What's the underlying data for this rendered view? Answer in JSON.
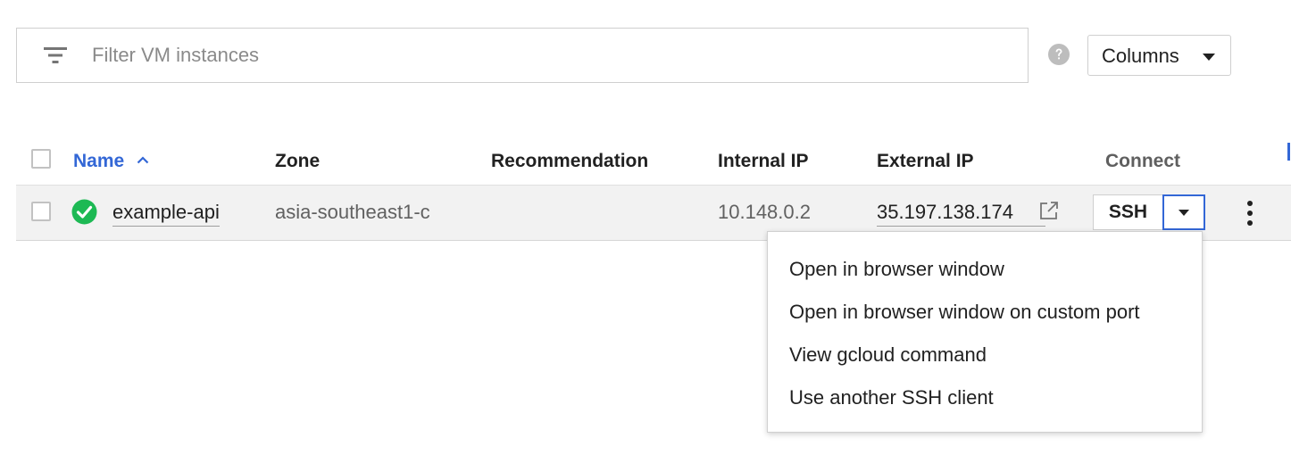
{
  "filter": {
    "placeholder": "Filter VM instances",
    "value": "",
    "icon": "filter-list-icon"
  },
  "help": {
    "icon": "help-icon"
  },
  "columns_button": {
    "label": "Columns",
    "icon": "arrow-drop-down-icon"
  },
  "table": {
    "headers": {
      "name": "Name",
      "zone": "Zone",
      "recommendation": "Recommendation",
      "internal_ip": "Internal IP",
      "external_ip": "External IP",
      "connect": "Connect"
    },
    "sort": {
      "column": "Name",
      "direction": "ascending",
      "icon": "arrow-up-icon"
    },
    "rows": [
      {
        "status": "running",
        "status_icon": "check-circle-icon",
        "status_color": "#1db954",
        "name": "example-api",
        "zone": "asia-southeast1-c",
        "recommendation": "",
        "internal_ip": "10.148.0.2",
        "external_ip": "35.197.138.174",
        "external_link_icon": "open-in-new-icon",
        "connect": {
          "label": "SSH",
          "dropdown_icon": "arrow-drop-down-icon"
        }
      }
    ]
  },
  "ssh_menu": {
    "items": [
      "Open in browser window",
      "Open in browser window on custom port",
      "View gcloud command",
      "Use another SSH client"
    ]
  },
  "colors": {
    "accent": "#3367d6",
    "row_bg": "#f2f2f2",
    "success": "#1db954"
  }
}
